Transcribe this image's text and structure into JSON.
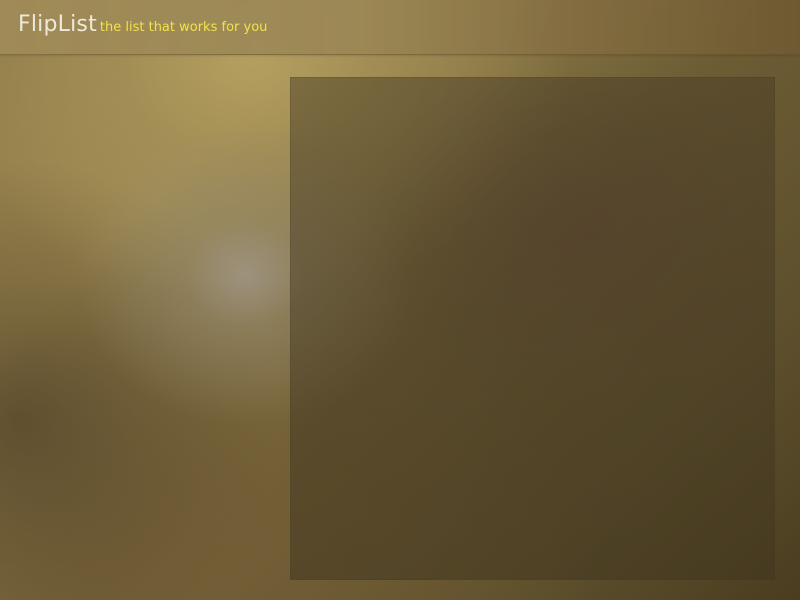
{
  "header": {
    "logo": "FlipList",
    "tagline": "the list that works for you"
  },
  "colors": {
    "logo_text": "#efe9dc",
    "tagline_text": "#f2e24b"
  }
}
